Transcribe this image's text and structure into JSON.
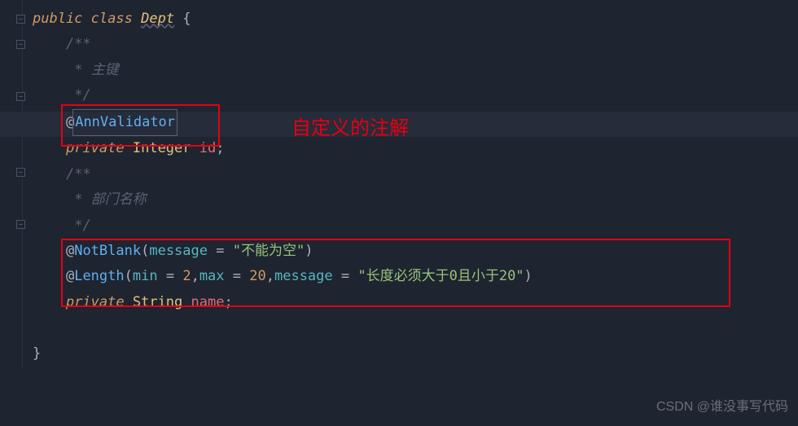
{
  "code": {
    "line1_public": "public",
    "line1_class": "class",
    "line1_name": "Dept",
    "line1_brace": " {",
    "line2_comment": "/**",
    "line3_comment": " * 主键",
    "line4_comment": " */",
    "line5_at": "@",
    "line5_ann": "AnnValidator",
    "line6_private": "private",
    "line6_type": "Integer",
    "line6_field": "id",
    "line6_semi": ";",
    "line7_comment": "/**",
    "line8_comment": " * 部门名称",
    "line9_comment": " */",
    "line10_at": "@",
    "line10_ann": "NotBlank",
    "line10_lparen": "(",
    "line10_param": "message",
    "line10_eq": " = ",
    "line10_str": "\"不能为空\"",
    "line10_rparen": ")",
    "line11_at": "@",
    "line11_ann": "Length",
    "line11_lparen": "(",
    "line11_p1": "min",
    "line11_eq1": " = ",
    "line11_v1": "2",
    "line11_c1": ",",
    "line11_p2": "max",
    "line11_eq2": " = ",
    "line11_v2": "20",
    "line11_c2": ",",
    "line11_p3": "message",
    "line11_eq3": " = ",
    "line11_str": "\"长度必须大于0且小于20\"",
    "line11_rparen": ")",
    "line12_private": "private",
    "line12_type": "String",
    "line12_field": "name",
    "line12_semi": ";",
    "line14_brace": "}"
  },
  "annotations": {
    "red_label": "自定义的注解",
    "watermark": "CSDN @谁没事写代码"
  }
}
